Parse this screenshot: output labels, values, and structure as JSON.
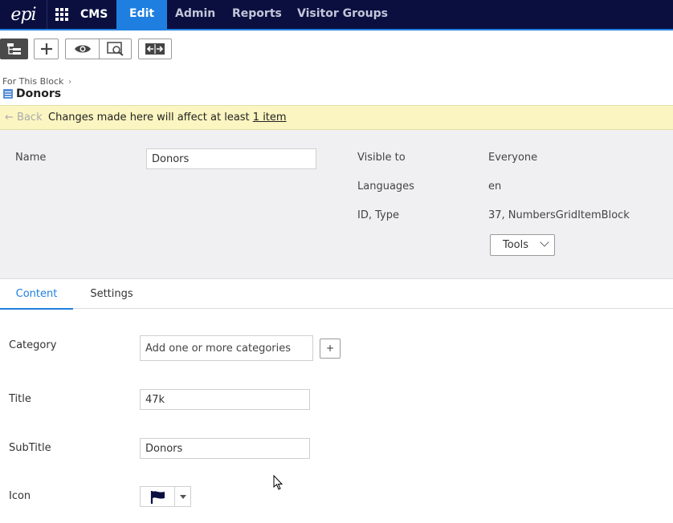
{
  "nav": {
    "logo": "epi",
    "product": "CMS",
    "items": [
      {
        "label": "Edit",
        "active": true
      },
      {
        "label": "Admin",
        "active": false
      },
      {
        "label": "Reports",
        "active": false
      },
      {
        "label": "Visitor Groups",
        "active": false
      }
    ]
  },
  "header": {
    "breadcrumb": "For This Block",
    "title": "Donors"
  },
  "notice": {
    "back_label": "Back",
    "message": "Changes made here will affect at least ",
    "link": "1 item"
  },
  "properties": {
    "name_label": "Name",
    "name_value": "Donors",
    "visible_label": "Visible to",
    "visible_value": "Everyone",
    "languages_label": "Languages",
    "languages_value": "en",
    "idtype_label": "ID, Type",
    "idtype_value": "37, NumbersGridItemBlock",
    "tools_label": "Tools"
  },
  "tabs": [
    {
      "label": "Content",
      "active": true
    },
    {
      "label": "Settings",
      "active": false
    }
  ],
  "form": {
    "category_label": "Category",
    "category_value": "Add one or more categories",
    "plus_label": "+",
    "title_label": "Title",
    "title_value": "47k",
    "subtitle_label": "SubTitle",
    "subtitle_value": "Donors",
    "icon_label": "Icon",
    "icon_value": "flag-icon"
  },
  "colors": {
    "nav_bg": "#0a0f3f",
    "accent": "#1f7fe0",
    "notice_bg": "#fbf5c1",
    "panel_bg": "#f0f0f2"
  }
}
